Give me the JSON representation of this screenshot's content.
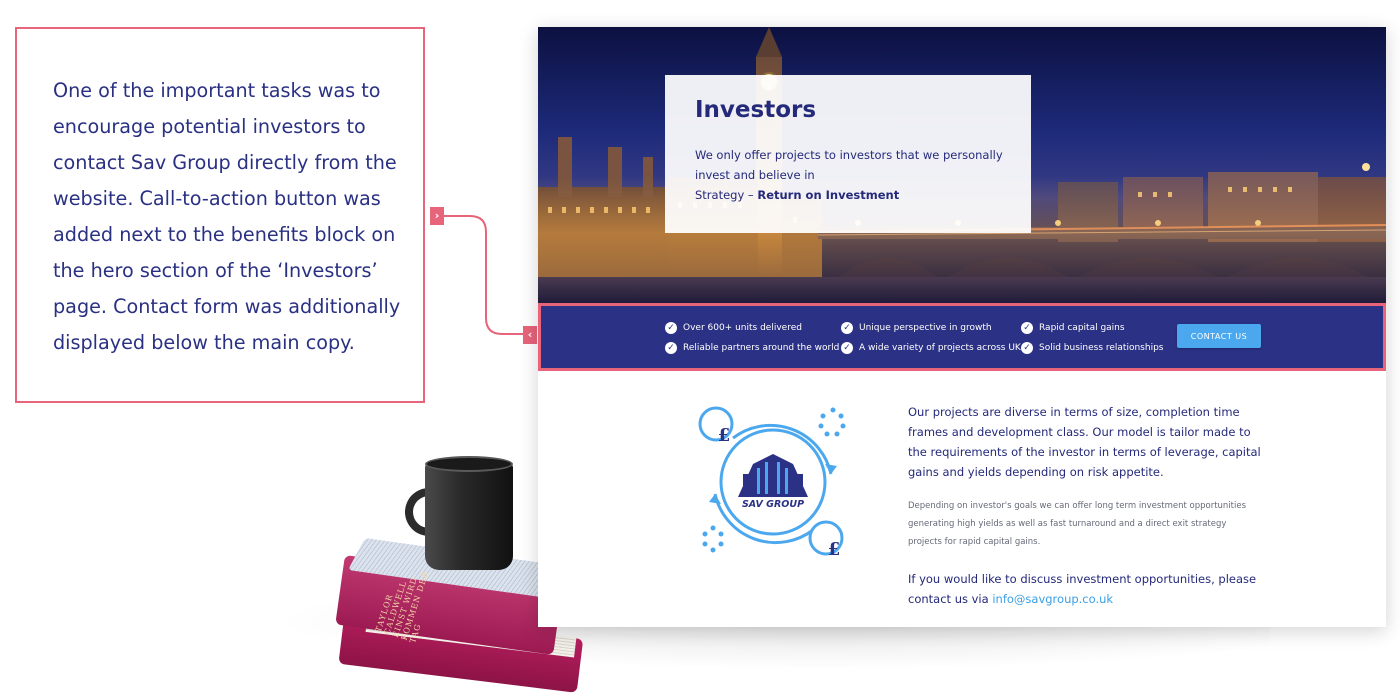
{
  "annotation": {
    "text": "One of the important tasks was to encourage potential investors to contact Sav Group directly from the website. Call-to-action button was added next to the benefits block on the hero section of the ‘Investors’ page. Contact form was additionally displayed below the main copy."
  },
  "connector": {
    "tag_left_glyph": "›",
    "tag_right_glyph": "‹",
    "color": "#e8647a"
  },
  "hero": {
    "title": "Investors",
    "text_line": "We only offer projects to investors that we personally invest and believe in",
    "strategy_prefix": "Strategy –",
    "strategy_bold": "Return on Investment"
  },
  "benefits": {
    "items": [
      "Over 600+ units delivered",
      "Reliable partners around the world",
      "Unique perspective in growth",
      "A wide variety of projects across UK",
      "Rapid capital gains",
      "Solid business relationships"
    ],
    "contact_button": "CONTACT US",
    "background": "#2b3184",
    "button_color": "#4ba8ee"
  },
  "logo": {
    "brand_name": "SAV GROUP",
    "currency_symbol": "£"
  },
  "content": {
    "lead": "Our projects are diverse in terms of size, completion time frames and development class. Our model is tailor made to the requirements of the investor in terms of leverage, capital gains and yields depending on risk appetite.",
    "small": "Depending on investor's goals we can offer long term investment opportunities generating high yields as well as fast turnaround and a direct exit strategy projects for rapid capital gains.",
    "cta_text": "If you would like to discuss investment opportunities, please contact us via",
    "cta_email": "info@savgroup.co.uk"
  },
  "decor": {
    "book_spine": "TAYLOR CALDWELL EINST WIRD KOMMEN DER TAG"
  },
  "colors": {
    "accent": "#e8647a",
    "navy": "#2a3183",
    "link": "#3a9fe6"
  }
}
